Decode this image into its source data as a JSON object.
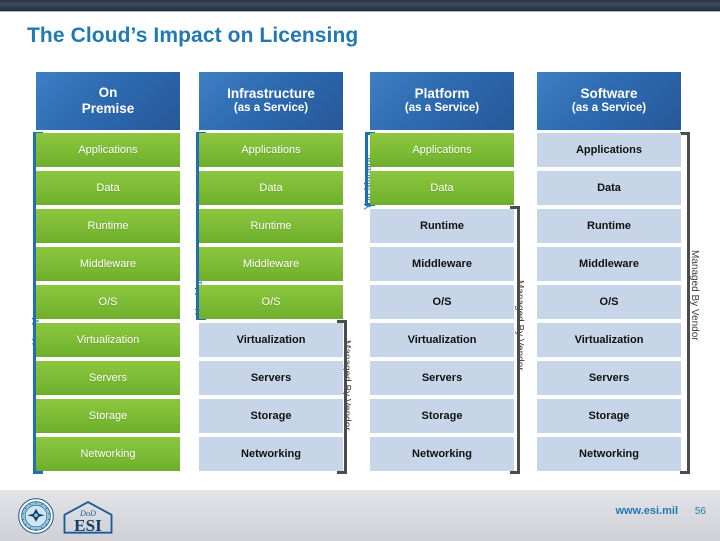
{
  "slide": {
    "title": "The Cloud’s Impact on Licensing",
    "top_bar": "dark-navy-bar"
  },
  "columns": [
    {
      "id": "on-premise",
      "header_line1": "On",
      "header_line2": "Premise",
      "two_line_title": true,
      "cells": [
        {
          "label": "Applications",
          "style": "green"
        },
        {
          "label": "Data",
          "style": "green"
        },
        {
          "label": "Runtime",
          "style": "green"
        },
        {
          "label": "Middleware",
          "style": "green"
        },
        {
          "label": "O/S",
          "style": "green"
        },
        {
          "label": "Virtualization",
          "style": "green"
        },
        {
          "label": "Servers",
          "style": "green"
        },
        {
          "label": "Storage",
          "style": "green"
        },
        {
          "label": "Networking",
          "style": "green"
        }
      ]
    },
    {
      "id": "infrastructure-as-a-service",
      "header_line1": "Infrastructure",
      "header_line2": "(as a Service)",
      "two_line_title": false,
      "cells": [
        {
          "label": "Applications",
          "style": "green"
        },
        {
          "label": "Data",
          "style": "green"
        },
        {
          "label": "Runtime",
          "style": "green"
        },
        {
          "label": "Middleware",
          "style": "green"
        },
        {
          "label": "O/S",
          "style": "green"
        },
        {
          "label": "Virtualization",
          "style": "blue"
        },
        {
          "label": "Servers",
          "style": "blue"
        },
        {
          "label": "Storage",
          "style": "blue"
        },
        {
          "label": "Networking",
          "style": "blue"
        }
      ]
    },
    {
      "id": "platform-as-a-service",
      "header_line1": "Platform",
      "header_line2": "(as a Service)",
      "two_line_title": false,
      "cells": [
        {
          "label": "Applications",
          "style": "green"
        },
        {
          "label": "Data",
          "style": "green"
        },
        {
          "label": "Runtime",
          "style": "blue"
        },
        {
          "label": "Middleware",
          "style": "blue"
        },
        {
          "label": "O/S",
          "style": "blue"
        },
        {
          "label": "Virtualization",
          "style": "blue"
        },
        {
          "label": "Servers",
          "style": "blue"
        },
        {
          "label": "Storage",
          "style": "blue"
        },
        {
          "label": "Networking",
          "style": "blue"
        }
      ]
    },
    {
      "id": "software-as-a-service",
      "header_line1": "Software",
      "header_line2": "(as a Service)",
      "two_line_title": false,
      "cells": [
        {
          "label": "Applications",
          "style": "blue"
        },
        {
          "label": "Data",
          "style": "blue"
        },
        {
          "label": "Runtime",
          "style": "blue"
        },
        {
          "label": "Middleware",
          "style": "blue"
        },
        {
          "label": "O/S",
          "style": "blue"
        },
        {
          "label": "Virtualization",
          "style": "blue"
        },
        {
          "label": "Servers",
          "style": "blue"
        },
        {
          "label": "Storage",
          "style": "blue"
        },
        {
          "label": "Networking",
          "style": "blue"
        }
      ]
    }
  ],
  "brackets": {
    "you_manage_label": "You Manage",
    "managed_by_vendor_label": "Managed By Vendor"
  },
  "footer": {
    "site_url": "www.esi.mil",
    "page_number": "56",
    "logo_dod_name": "dod-seal-logo",
    "logo_esi_name": "dod-esi-logo",
    "logo_esi_top_text": "DoD",
    "logo_esi_main_text": "ESI"
  },
  "colors": {
    "title_blue": "#1f7ab4",
    "header_blue": "#2d6ab0",
    "cell_green": "#7cbb35",
    "cell_blue": "#c6d6e8",
    "bracket_blue": "#1f6fb2",
    "bracket_gray": "#4c4c4c",
    "footer_bg": "#d8d9de",
    "top_bar": "#2b3543"
  }
}
